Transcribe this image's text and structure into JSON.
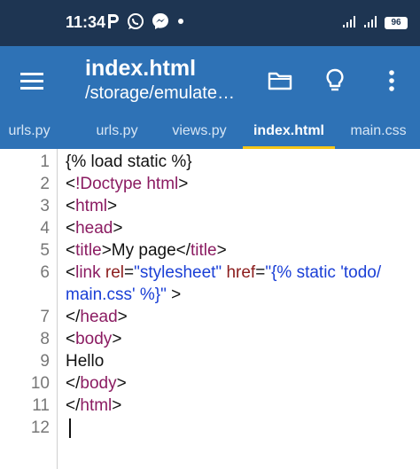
{
  "status_bar": {
    "time": "11:34",
    "notification_icons": [
      "parking-icon",
      "whatsapp-icon",
      "messenger-icon",
      "dot-icon"
    ],
    "battery_level": "96"
  },
  "app_bar": {
    "title": "index.html",
    "path": "/storage/emulate…",
    "background": "#2e72b6"
  },
  "tabs": [
    {
      "label": "urls.py"
    },
    {
      "label": "urls.py"
    },
    {
      "label": "views.py"
    },
    {
      "label": "index.html"
    },
    {
      "label": "main.css"
    }
  ],
  "active_tab_index": 3,
  "editor": {
    "line_numbers": [
      "1",
      "2",
      "3",
      "4",
      "5",
      "6",
      "7",
      "8",
      "9",
      "10",
      "11",
      "12"
    ],
    "lines": [
      {
        "segments": [
          {
            "text": "{% load static %}",
            "kind": "plain"
          }
        ]
      },
      {
        "segments": [
          {
            "text": "<",
            "kind": "plain"
          },
          {
            "text": "!Doctype html",
            "kind": "tag"
          },
          {
            "text": ">",
            "kind": "plain"
          }
        ]
      },
      {
        "segments": [
          {
            "text": "<",
            "kind": "plain"
          },
          {
            "text": "html",
            "kind": "tag"
          },
          {
            "text": ">",
            "kind": "plain"
          }
        ]
      },
      {
        "segments": [
          {
            "text": "<",
            "kind": "plain"
          },
          {
            "text": "head",
            "kind": "tag"
          },
          {
            "text": ">",
            "kind": "plain"
          }
        ]
      },
      {
        "segments": [
          {
            "text": "<",
            "kind": "plain"
          },
          {
            "text": "title",
            "kind": "tag"
          },
          {
            "text": ">My page</",
            "kind": "plain"
          },
          {
            "text": "title",
            "kind": "tag"
          },
          {
            "text": ">",
            "kind": "plain"
          }
        ]
      },
      {
        "segments": [
          {
            "text": "<",
            "kind": "plain"
          },
          {
            "text": "link",
            "kind": "tag"
          },
          {
            "text": " ",
            "kind": "plain"
          },
          {
            "text": "rel",
            "kind": "attr"
          },
          {
            "text": "=",
            "kind": "plain"
          },
          {
            "text": "\"stylesheet\"",
            "kind": "str"
          },
          {
            "text": " ",
            "kind": "plain"
          },
          {
            "text": "href",
            "kind": "attr"
          },
          {
            "text": "=",
            "kind": "plain"
          },
          {
            "text": "\"{% static 'todo/",
            "kind": "str"
          }
        ]
      },
      {
        "segments": [
          {
            "text": "main.css' %}\"",
            "kind": "str"
          },
          {
            "text": " >",
            "kind": "plain"
          }
        ]
      },
      {
        "segments": [
          {
            "text": "</",
            "kind": "plain"
          },
          {
            "text": "head",
            "kind": "tag"
          },
          {
            "text": ">",
            "kind": "plain"
          }
        ]
      },
      {
        "segments": [
          {
            "text": "<",
            "kind": "plain"
          },
          {
            "text": "body",
            "kind": "tag"
          },
          {
            "text": ">",
            "kind": "plain"
          }
        ]
      },
      {
        "segments": [
          {
            "text": "Hello",
            "kind": "plain"
          }
        ]
      },
      {
        "segments": [
          {
            "text": "</",
            "kind": "plain"
          },
          {
            "text": "body",
            "kind": "tag"
          },
          {
            "text": ">",
            "kind": "plain"
          }
        ]
      },
      {
        "segments": [
          {
            "text": "</",
            "kind": "plain"
          },
          {
            "text": "html",
            "kind": "tag"
          },
          {
            "text": ">",
            "kind": "plain"
          }
        ]
      },
      {
        "segments": []
      }
    ],
    "row_line_numbers": [
      "1",
      "2",
      "3",
      "4",
      "5",
      "6",
      "",
      "7",
      "8",
      "9",
      "10",
      "11",
      "12"
    ]
  }
}
